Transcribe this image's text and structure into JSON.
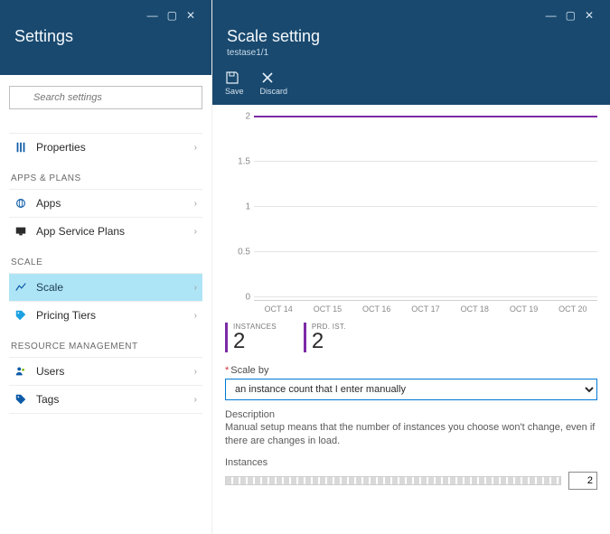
{
  "left": {
    "title": "Settings",
    "search_placeholder": "Search settings",
    "groups": [
      {
        "label": "",
        "items": [
          {
            "id": "properties",
            "label": "Properties"
          }
        ]
      },
      {
        "label": "APPS & PLANS",
        "items": [
          {
            "id": "apps",
            "label": "Apps"
          },
          {
            "id": "app-service-plans",
            "label": "App Service Plans"
          }
        ]
      },
      {
        "label": "SCALE",
        "items": [
          {
            "id": "scale",
            "label": "Scale",
            "selected": true
          },
          {
            "id": "pricing-tiers",
            "label": "Pricing Tiers"
          }
        ]
      },
      {
        "label": "RESOURCE MANAGEMENT",
        "items": [
          {
            "id": "users",
            "label": "Users"
          },
          {
            "id": "tags",
            "label": "Tags"
          }
        ]
      }
    ]
  },
  "right": {
    "title": "Scale setting",
    "subtitle": "testase1/1",
    "toolbar": {
      "save": "Save",
      "discard": "Discard"
    },
    "stats": [
      {
        "label": "INSTANCES",
        "value": "2"
      },
      {
        "label": "PRD. IST.",
        "value": "2"
      }
    ],
    "scale_by": {
      "label": "Scale by",
      "value": "an instance count that I enter manually"
    },
    "description": {
      "heading": "Description",
      "text": "Manual setup means that the number of instances you choose won't change, even if there are changes in load."
    },
    "instances": {
      "heading": "Instances",
      "value": "2"
    }
  },
  "chart_data": {
    "type": "line",
    "title": "",
    "xlabel": "",
    "ylabel": "",
    "ylim": [
      0,
      2
    ],
    "y_ticks": [
      0,
      0.5,
      1,
      1.5,
      2
    ],
    "categories": [
      "OCT 14",
      "OCT 15",
      "OCT 16",
      "OCT 17",
      "OCT 18",
      "OCT 19",
      "OCT 20"
    ],
    "series": [
      {
        "name": "Instances",
        "color": "#7c2aa6",
        "values": [
          2,
          2,
          2,
          2,
          2,
          2,
          2
        ]
      }
    ]
  }
}
